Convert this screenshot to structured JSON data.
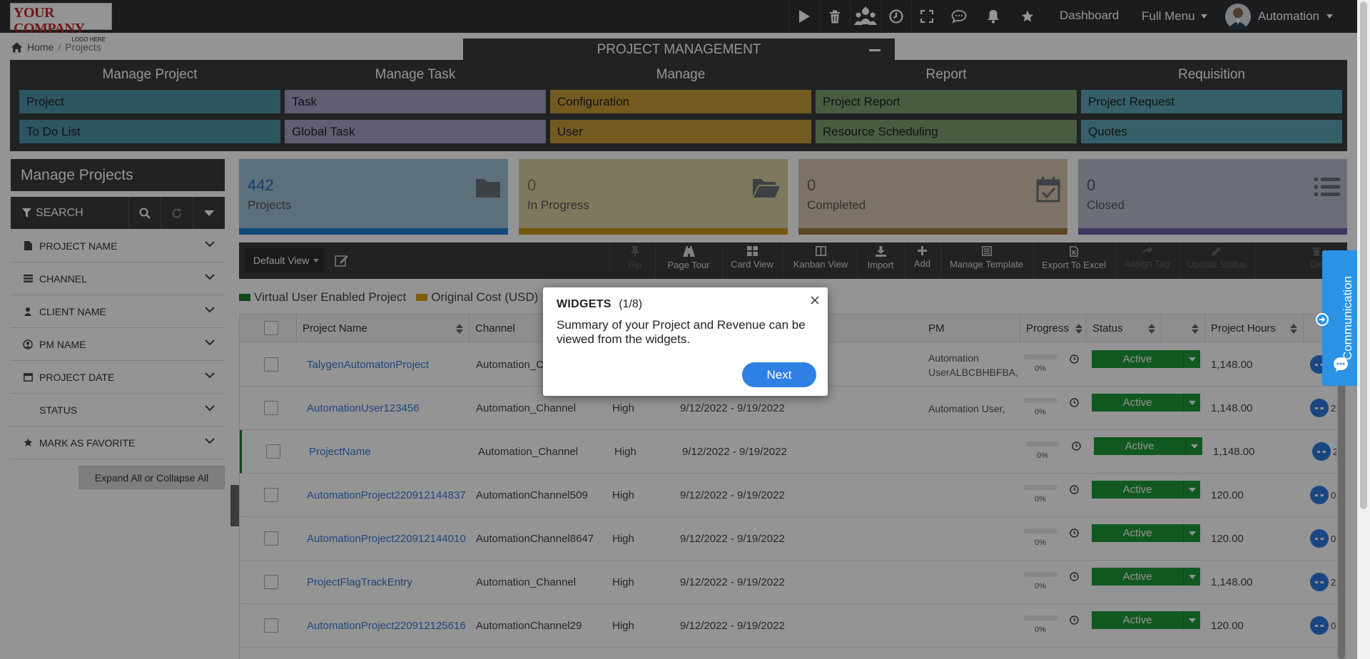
{
  "topbar": {
    "logo_line1": "YOUR COMPANY",
    "logo_line2": "LOGO HERE",
    "icons": [
      "play-icon",
      "trash-icon",
      "people-alert-icon",
      "clock-icon",
      "fullscreen-icon",
      "chat-icon",
      "bell-icon",
      "star-icon"
    ],
    "dashboard_label": "Dashboard",
    "full_menu_label": "Full Menu",
    "user_name": "Automation"
  },
  "breadcrumb": {
    "home": "Home",
    "separator": "/",
    "current": "Projects"
  },
  "project_management": {
    "title": "PROJECT MANAGEMENT",
    "columns": [
      {
        "header": "Manage Project",
        "items": [
          "Project",
          "To Do List"
        ],
        "color": "#4d95a8"
      },
      {
        "header": "Manage Task",
        "items": [
          "Task",
          "Global Task"
        ],
        "color": "#a9a1c6"
      },
      {
        "header": "Manage",
        "items": [
          "Configuration",
          "User"
        ],
        "color": "#c79c3a"
      },
      {
        "header": "Report",
        "items": [
          "Project Report",
          "Resource Scheduling"
        ],
        "color": "#7da16e"
      },
      {
        "header": "Requisition",
        "items": [
          "Project Request",
          "Quotes"
        ],
        "color": "#5ea5b5"
      }
    ]
  },
  "sidebar": {
    "title": "Manage Projects",
    "search_label": "SEARCH",
    "filters": [
      "PROJECT NAME",
      "CHANNEL",
      "CLIENT NAME",
      "PM NAME",
      "PROJECT DATE",
      "STATUS",
      "MARK AS FAVORITE"
    ],
    "expand_label": "Expand All or Collapse All"
  },
  "cards": [
    {
      "value": "442",
      "label": "Projects",
      "bg": "#9fc1d6",
      "bar": "#1f7fd0",
      "num_color": "#2769b5"
    },
    {
      "value": "0",
      "label": "In Progress",
      "bg": "#d9cfa3",
      "bar": "#c4991c",
      "num_color": "#8c7a3a"
    },
    {
      "value": "0",
      "label": "Completed",
      "bg": "#d6c7b0",
      "bar": "#a0763f",
      "num_color": "#6f6255"
    },
    {
      "value": "0",
      "label": "Closed",
      "bg": "#b8bdd1",
      "bar": "#6b5fa8",
      "num_color": "#585c70"
    }
  ],
  "toolbar": {
    "view_label": "Default View",
    "tools": [
      {
        "label": "Pin",
        "icon": "pin-icon",
        "enabled": false
      },
      {
        "label": "Page Tour",
        "icon": "road-icon",
        "enabled": true
      },
      {
        "label": "Card View",
        "icon": "grid-icon",
        "enabled": true
      },
      {
        "label": "Kanban View",
        "icon": "columns-icon",
        "enabled": true
      },
      {
        "label": "Import",
        "icon": "download-icon",
        "enabled": true
      },
      {
        "label": "Add",
        "icon": "plus-icon",
        "enabled": true
      },
      {
        "label": "Manage Template",
        "icon": "template-icon",
        "enabled": true
      },
      {
        "label": "Export To Excel",
        "icon": "excel-icon",
        "enabled": true
      },
      {
        "label": "Assign Tag",
        "icon": "share-icon",
        "enabled": false
      },
      {
        "label": "Update Status",
        "icon": "pencil-icon",
        "enabled": false
      },
      {
        "label": "De",
        "icon": "delete-icon",
        "enabled": false
      }
    ]
  },
  "legend": [
    {
      "label": "Virtual User Enabled Project",
      "color": "#1e7b2d"
    },
    {
      "label": "Original Cost (USD)",
      "color": "#d8a21b"
    }
  ],
  "table": {
    "columns": [
      "Project Name",
      "Channel",
      "",
      "",
      "PM",
      "Progress",
      "Status",
      "Project Hours"
    ],
    "rows": [
      {
        "name": "TalygenAutomatonProject",
        "channel": "Automation_C",
        "priority": "",
        "dates": "",
        "pm": "Automation UserALBCBHBFBA,",
        "progress": "0%",
        "status": "Active",
        "hours": "1,148.00",
        "extra": ""
      },
      {
        "name": "AutomationUser123456",
        "channel": "Automation_Channel",
        "priority": "High",
        "dates": "9/12/2022 - 9/19/2022",
        "pm": "Automation User,",
        "progress": "0%",
        "status": "Active",
        "hours": "1,148.00",
        "extra": "2"
      },
      {
        "name": "ProjectName",
        "channel": "Automation_Channel",
        "priority": "High",
        "dates": "9/12/2022 - 9/19/2022",
        "pm": "",
        "progress": "0%",
        "status": "Active",
        "hours": "1,148.00",
        "extra": "2"
      },
      {
        "name": "AutomationProject220912144837",
        "channel": "AutomationChannel509",
        "priority": "High",
        "dates": "9/12/2022 - 9/19/2022",
        "pm": "",
        "progress": "0%",
        "status": "Active",
        "hours": "120.00",
        "extra": "0"
      },
      {
        "name": "AutomationProject220912144010",
        "channel": "AutomationChannel8647",
        "priority": "High",
        "dates": "9/12/2022 - 9/19/2022",
        "pm": "",
        "progress": "0%",
        "status": "Active",
        "hours": "120.00",
        "extra": "0"
      },
      {
        "name": "ProjectFlagTrackEntry",
        "channel": "Automation_Channel",
        "priority": "High",
        "dates": "9/12/2022 - 9/19/2022",
        "pm": "",
        "progress": "0%",
        "status": "Active",
        "hours": "1,148.00",
        "extra": "2"
      },
      {
        "name": "AutomationProject220912125616",
        "channel": "AutomationChannel29",
        "priority": "High",
        "dates": "9/12/2022 - 9/19/2022",
        "pm": "",
        "progress": "0%",
        "status": "Active",
        "hours": "120.00",
        "extra": "0"
      }
    ]
  },
  "tour_popup": {
    "title": "WIDGETS",
    "step": "(1/8)",
    "body": "Summary of your Project and Revenue can be viewed from the widgets.",
    "next_label": "Next"
  },
  "communication_tab": {
    "label": "Communication"
  }
}
